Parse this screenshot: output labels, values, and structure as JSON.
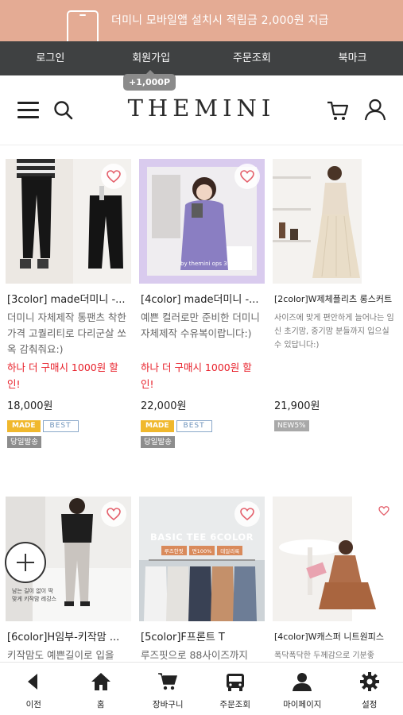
{
  "banner": {
    "text": "더미니 모바일앱 설치시 적립금 2,000원 지급"
  },
  "member_nav": {
    "items": [
      {
        "label": "로그인"
      },
      {
        "label": "회원가입"
      },
      {
        "label": "주문조회"
      },
      {
        "label": "북마크"
      }
    ]
  },
  "join_badge": "+1,000P",
  "header": {
    "logo": "THEMINI"
  },
  "products": [
    {
      "name": "[3color] made더미니 -...",
      "desc": "더미니 자체제작 통팬츠 착한가격 고퀄리티로 다리군살 쏘옥 감춰줘요:)",
      "promo": "하나 더 구매시 1000원 할인!",
      "price": "18,000원",
      "tags": [
        "MADE",
        "BEST"
      ],
      "ship": "당일발송"
    },
    {
      "name": "[4color] made더미니 -...",
      "desc": "예쁜 컬러로만 준비한 더미니 자체제작 수유복이랍니다:)",
      "promo": "하나 더 구매시 1000원 할인!",
      "price": "22,000원",
      "tags": [
        "MADE",
        "BEST"
      ],
      "ship": "당일발송",
      "image_text": "by themini ops 3 color"
    },
    {
      "name": "[2color]W제체플리츠 롱스커트",
      "desc": "사이즈에 맞게 편안하게 늘어나는 임신 초기맘, 중기맘 분들까지 입으실 수 있답니다:)",
      "price": "21,900원",
      "tags": [
        "NEW5%"
      ]
    },
    {
      "name": "[6color]H임부-키작맘 ...",
      "desc": "키작맘도 예쁜길이로 입을",
      "image_text": "남는 길이 없이 딱 맞게 키작맘 레깅스"
    },
    {
      "name": "[5color]F프론트 T",
      "desc": "루즈핏으로 88사이즈까지",
      "image_text": "BASIC TEE 6COLOR",
      "image_chips": [
        "루즈한핏",
        "면100%",
        "데일리룩"
      ]
    },
    {
      "name": "[4color]W캐스퍼 니트원피스",
      "desc": "폭닥폭닥한 두께감으로 기분좋"
    }
  ],
  "bottom_nav": {
    "items": [
      {
        "label": "이전",
        "icon": "back-icon"
      },
      {
        "label": "홈",
        "icon": "home-icon"
      },
      {
        "label": "장바구니",
        "icon": "cart-icon"
      },
      {
        "label": "주문조회",
        "icon": "order-icon"
      },
      {
        "label": "마이페이지",
        "icon": "person-icon"
      },
      {
        "label": "설정",
        "icon": "gear-icon"
      }
    ]
  },
  "colors": {
    "banner": "#e4ab94",
    "nav": "#3f4142",
    "promo": "#e8202a",
    "made": "#f0b82d",
    "best": "#6e93bb"
  }
}
